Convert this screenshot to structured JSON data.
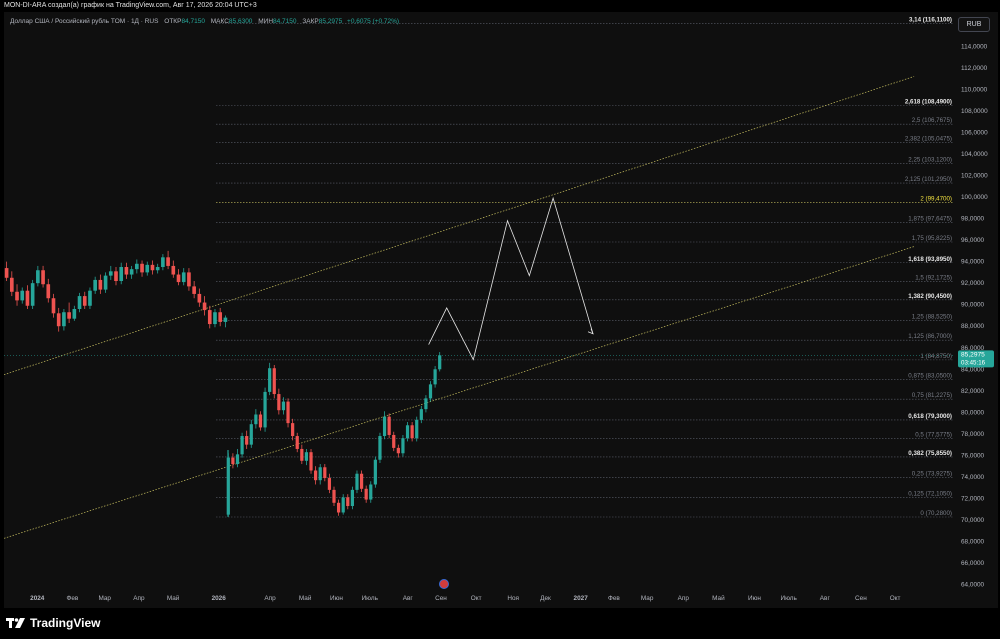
{
  "caption": "MON-DI-ARA создал(а) график на TradingView.com, Авг 17, 2026 20:04 UTC+3",
  "legend": {
    "symbol": "Доллар США / Российский рубль TOM · 1Д · RUS",
    "open_label": "ОТКР",
    "open": "84,7150",
    "high_label": "МАКС",
    "high": "85,6300",
    "low_label": "МИН",
    "low": "84,7150",
    "close_label": "ЗАКР",
    "close": "85,2975",
    "change": "+0,6075 (+0,72%)"
  },
  "currency": "RUB",
  "brand": "TradingView",
  "colors": {
    "up": "#26a69a",
    "down": "#ef5350",
    "fib": "#5b5f6b",
    "channel": "#c8c060",
    "projection": "#e6e6e6",
    "highlight": "#f0e040"
  },
  "chart_data": {
    "type": "candlestick",
    "y_range": [
      63.5,
      117
    ],
    "y_ticks": [
      "64,0000",
      "66,0000",
      "68,0000",
      "70,0000",
      "72,0000",
      "74,0000",
      "76,0000",
      "78,0000",
      "80,0000",
      "82,0000",
      "84,0000",
      "86,0000",
      "88,0000",
      "90,0000",
      "92,0000",
      "94,0000",
      "96,0000",
      "98,0000",
      "100,0000",
      "102,0000",
      "104,0000",
      "106,0000",
      "108,0000",
      "110,0000",
      "112,0000",
      "114,0000"
    ],
    "y_tick_values": [
      64,
      66,
      68,
      70,
      72,
      74,
      76,
      78,
      80,
      82,
      84,
      86,
      88,
      90,
      92,
      94,
      96,
      98,
      100,
      102,
      104,
      106,
      108,
      110,
      112,
      114
    ],
    "x_labels": [
      {
        "text": "2024",
        "bold": true,
        "t": 0.035
      },
      {
        "text": "Фев",
        "t": 0.072
      },
      {
        "text": "Мар",
        "t": 0.106
      },
      {
        "text": "Апр",
        "t": 0.142
      },
      {
        "text": "Май",
        "t": 0.178
      },
      {
        "text": "2026",
        "bold": true,
        "t": 0.226
      },
      {
        "text": "Апр",
        "t": 0.28
      },
      {
        "text": "Май",
        "t": 0.317
      },
      {
        "text": "Июн",
        "t": 0.35
      },
      {
        "text": "Июль",
        "t": 0.385
      },
      {
        "text": "Авг",
        "t": 0.425
      },
      {
        "text": "Сен",
        "t": 0.46
      },
      {
        "text": "Окт",
        "t": 0.497
      },
      {
        "text": "Ноя",
        "t": 0.536
      },
      {
        "text": "Дек",
        "t": 0.57
      },
      {
        "text": "2027",
        "bold": true,
        "t": 0.607
      },
      {
        "text": "Фев",
        "t": 0.642
      },
      {
        "text": "Мар",
        "t": 0.677
      },
      {
        "text": "Апр",
        "t": 0.715
      },
      {
        "text": "Май",
        "t": 0.752
      },
      {
        "text": "Июн",
        "t": 0.79
      },
      {
        "text": "Июль",
        "t": 0.826
      },
      {
        "text": "Авг",
        "t": 0.864
      },
      {
        "text": "Сен",
        "t": 0.902
      },
      {
        "text": "Окт",
        "t": 0.938
      }
    ],
    "fib_levels": [
      {
        "label": "3,14 (116,1100)",
        "value": 116.11,
        "bold": true
      },
      {
        "label": "2,618 (108,4900)",
        "value": 108.49,
        "bold": true
      },
      {
        "label": "2,5 (106,7675)",
        "value": 106.7675
      },
      {
        "label": "2,382 (105,0475)",
        "value": 105.0475
      },
      {
        "label": "2,25 (103,1200)",
        "value": 103.12
      },
      {
        "label": "2,125 (101,2950)",
        "value": 101.295
      },
      {
        "label": "2 (99,4700)",
        "value": 99.47,
        "highlight": true
      },
      {
        "label": "1,875 (97,6475)",
        "value": 97.6475
      },
      {
        "label": "1,75 (95,8225)",
        "value": 95.8225
      },
      {
        "label": "1,618 (93,8950)",
        "value": 93.895,
        "bold": true
      },
      {
        "label": "1,5 (92,1725)",
        "value": 92.1725
      },
      {
        "label": "1,382 (90,4500)",
        "value": 90.45,
        "bold": true
      },
      {
        "label": "1,25 (88,5250)",
        "value": 88.525
      },
      {
        "label": "1,125 (86,7000)",
        "value": 86.7
      },
      {
        "label": "1 (84,8750)",
        "value": 84.875
      },
      {
        "label": "0,875 (83,0500)",
        "value": 83.05
      },
      {
        "label": "0,75 (81,2275)",
        "value": 81.2275
      },
      {
        "label": "0,618 (79,3000)",
        "value": 79.3,
        "bold": true
      },
      {
        "label": "0,5 (77,5775)",
        "value": 77.5775
      },
      {
        "label": "0,382 (75,8550)",
        "value": 75.855,
        "bold": true
      },
      {
        "label": "0,25 (73,9275)",
        "value": 73.9275
      },
      {
        "label": "0,125 (72,1050)",
        "value": 72.105
      },
      {
        "label": "0 (70,2800)",
        "value": 70.28
      }
    ],
    "last_price": {
      "value": 85.2975,
      "label": "85,2975",
      "countdown": "03:45:16"
    },
    "segment_2024": [
      [
        93.4,
        94.0,
        92.2,
        92.5
      ],
      [
        92.5,
        93.1,
        90.8,
        91.2
      ],
      [
        91.2,
        91.9,
        89.9,
        90.4
      ],
      [
        90.4,
        91.6,
        90.1,
        91.3
      ],
      [
        91.3,
        91.8,
        89.6,
        89.9
      ],
      [
        89.9,
        92.3,
        89.6,
        92.0
      ],
      [
        92.0,
        93.6,
        91.7,
        93.2
      ],
      [
        93.2,
        93.6,
        91.6,
        91.9
      ],
      [
        91.9,
        92.4,
        90.2,
        90.6
      ],
      [
        90.6,
        91.0,
        88.8,
        89.2
      ],
      [
        89.2,
        89.7,
        87.5,
        88.0
      ],
      [
        88.0,
        89.6,
        87.6,
        89.3
      ],
      [
        89.3,
        90.2,
        88.3,
        88.7
      ],
      [
        88.7,
        89.9,
        88.5,
        89.6
      ],
      [
        89.6,
        91.1,
        89.3,
        90.8
      ],
      [
        90.8,
        91.2,
        89.6,
        89.9
      ],
      [
        89.9,
        91.6,
        89.6,
        91.3
      ],
      [
        91.3,
        92.6,
        91.0,
        92.3
      ],
      [
        92.3,
        92.8,
        91.0,
        91.4
      ],
      [
        91.4,
        93.0,
        91.1,
        92.7
      ],
      [
        92.7,
        93.6,
        92.3,
        93.1
      ],
      [
        93.1,
        93.5,
        91.8,
        92.2
      ],
      [
        92.2,
        93.9,
        91.9,
        93.5
      ],
      [
        93.5,
        93.9,
        92.4,
        92.8
      ],
      [
        92.8,
        93.6,
        92.4,
        93.3
      ],
      [
        93.3,
        94.2,
        92.9,
        93.8
      ],
      [
        93.8,
        94.1,
        92.6,
        93.0
      ],
      [
        93.0,
        94.0,
        92.7,
        93.7
      ],
      [
        93.7,
        94.1,
        92.8,
        93.2
      ],
      [
        93.2,
        93.8,
        92.9,
        93.5
      ],
      [
        93.5,
        94.7,
        93.2,
        94.4
      ],
      [
        94.4,
        95.0,
        93.3,
        93.6
      ],
      [
        93.6,
        94.1,
        92.5,
        92.8
      ],
      [
        92.8,
        93.3,
        91.8,
        92.1
      ],
      [
        92.1,
        93.4,
        91.8,
        93.0
      ],
      [
        93.0,
        93.4,
        91.3,
        91.7
      ],
      [
        91.7,
        92.2,
        90.6,
        91.0
      ],
      [
        91.0,
        91.5,
        89.8,
        90.2
      ],
      [
        90.2,
        90.8,
        89.0,
        89.5
      ],
      [
        89.5,
        89.9,
        87.8,
        88.2
      ],
      [
        88.2,
        89.6,
        87.9,
        89.3
      ],
      [
        89.3,
        89.7,
        88.0,
        88.4
      ],
      [
        88.4,
        89.0,
        87.9,
        88.8
      ]
    ],
    "segment_2026": [
      [
        70.5,
        76.2,
        70.3,
        75.8
      ],
      [
        75.8,
        76.2,
        74.8,
        75.2
      ],
      [
        75.2,
        76.6,
        74.9,
        76.1
      ],
      [
        76.1,
        78.1,
        75.8,
        77.8
      ],
      [
        77.8,
        78.3,
        76.6,
        77.0
      ],
      [
        77.0,
        79.3,
        76.7,
        78.9
      ],
      [
        78.9,
        80.3,
        78.5,
        79.8
      ],
      [
        79.8,
        80.1,
        78.3,
        78.6
      ],
      [
        78.6,
        82.3,
        78.2,
        81.9
      ],
      [
        81.9,
        84.6,
        81.6,
        84.1
      ],
      [
        84.1,
        84.4,
        81.3,
        81.7
      ],
      [
        81.7,
        82.2,
        79.8,
        80.2
      ],
      [
        80.2,
        81.4,
        79.8,
        81.0
      ],
      [
        81.0,
        81.3,
        78.6,
        79.0
      ],
      [
        79.0,
        79.4,
        77.4,
        77.8
      ],
      [
        77.8,
        78.1,
        76.3,
        76.6
      ],
      [
        76.6,
        77.0,
        75.2,
        75.5
      ],
      [
        75.5,
        76.6,
        75.1,
        76.3
      ],
      [
        76.3,
        76.6,
        74.3,
        74.6
      ],
      [
        74.6,
        75.0,
        73.3,
        73.7
      ],
      [
        73.7,
        75.2,
        73.3,
        74.9
      ],
      [
        74.9,
        75.2,
        73.6,
        73.9
      ],
      [
        73.9,
        74.3,
        72.5,
        72.8
      ],
      [
        72.8,
        73.1,
        71.3,
        71.6
      ],
      [
        71.6,
        71.9,
        70.4,
        70.7
      ],
      [
        70.7,
        72.4,
        70.5,
        72.1
      ],
      [
        72.1,
        72.4,
        71.0,
        71.3
      ],
      [
        71.3,
        73.1,
        71.0,
        72.8
      ],
      [
        72.8,
        74.6,
        72.5,
        74.3
      ],
      [
        74.3,
        74.6,
        72.6,
        72.9
      ],
      [
        72.9,
        73.2,
        71.6,
        71.9
      ],
      [
        71.9,
        73.6,
        71.6,
        73.3
      ],
      [
        73.3,
        75.9,
        73.0,
        75.6
      ],
      [
        75.6,
        78.1,
        75.3,
        77.8
      ],
      [
        77.8,
        80.1,
        77.5,
        79.6
      ],
      [
        79.6,
        79.9,
        77.6,
        77.9
      ],
      [
        77.9,
        78.2,
        76.4,
        76.7
      ],
      [
        76.7,
        77.0,
        75.8,
        76.2
      ],
      [
        76.2,
        77.9,
        75.9,
        77.6
      ],
      [
        77.6,
        79.1,
        77.3,
        78.8
      ],
      [
        78.8,
        79.1,
        77.3,
        77.6
      ],
      [
        77.6,
        79.6,
        77.3,
        79.3
      ],
      [
        79.3,
        80.6,
        79.0,
        80.3
      ],
      [
        80.3,
        81.6,
        80.0,
        81.3
      ],
      [
        81.3,
        82.9,
        81.0,
        82.6
      ],
      [
        82.6,
        84.3,
        82.3,
        84.0
      ],
      [
        84.0,
        85.6,
        83.8,
        85.3
      ]
    ],
    "projection_path": [
      {
        "date_t": 0.447,
        "value": 86.3
      },
      {
        "date_t": 0.466,
        "value": 89.7
      },
      {
        "date_t": 0.494,
        "value": 84.9
      },
      {
        "date_t": 0.53,
        "value": 97.8
      },
      {
        "date_t": 0.553,
        "value": 92.7
      },
      {
        "date_t": 0.578,
        "value": 99.9
      },
      {
        "date_t": 0.62,
        "value": 87.3
      }
    ],
    "channel_lines": [
      {
        "from": {
          "date_t": 0.0,
          "value": 83.5
        },
        "to": {
          "date_t": 0.958,
          "value": 111.2
        }
      },
      {
        "from": {
          "date_t": 0.0,
          "value": 68.3
        },
        "to": {
          "date_t": 0.958,
          "value": 95.4
        }
      }
    ]
  }
}
